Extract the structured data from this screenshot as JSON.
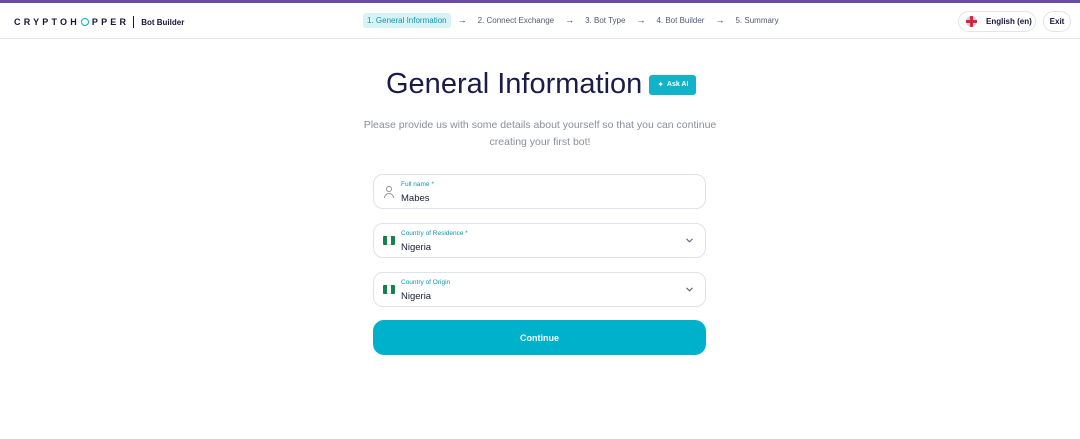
{
  "brand": {
    "logo": "CRYPTOHOPPER",
    "subtitle": "Bot Builder"
  },
  "steps": [
    {
      "label": "1. General Information",
      "active": true
    },
    {
      "label": "2. Connect Exchange",
      "active": false
    },
    {
      "label": "3. Bot Type",
      "active": false
    },
    {
      "label": "4. Bot Builder",
      "active": false
    },
    {
      "label": "5. Summary",
      "active": false
    }
  ],
  "step_arrow": "→",
  "language": {
    "label": "English (en)",
    "icon": "uk-flag-icon"
  },
  "exit_label": "Exit",
  "page": {
    "title": "General Information",
    "ask_ai_label": "Ask AI",
    "subtitle": "Please provide us with some details about yourself so that you can continue creating your first bot!"
  },
  "form": {
    "full_name": {
      "label": "Full name *",
      "value": "Mabes",
      "icon": "person-icon"
    },
    "country_residence": {
      "label": "Country of Residence *",
      "value": "Nigeria",
      "icon": "nigeria-flag-icon"
    },
    "country_origin": {
      "label": "Country of Origin",
      "value": "Nigeria",
      "icon": "nigeria-flag-icon"
    }
  },
  "continue_label": "Continue",
  "colors": {
    "accent": "#00b1cc",
    "title": "#1b1c48",
    "top_bar": "#6b4aa0",
    "active_step_bg": "#d8f3f6"
  }
}
